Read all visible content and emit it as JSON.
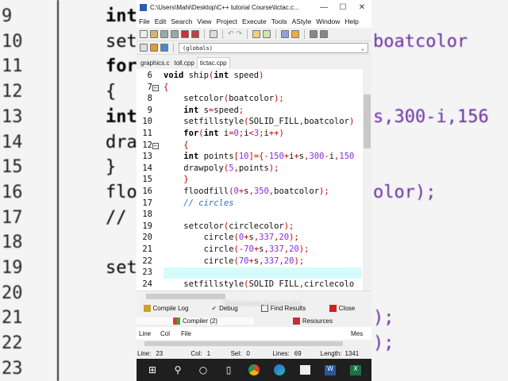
{
  "window": {
    "title": "C:\\Users\\Mahi\\Desktop\\C++ tutorial Course\\tictac.c...",
    "minimize": "—",
    "maximize": "☐",
    "close": "✕"
  },
  "menu": [
    "File",
    "Edit",
    "Search",
    "View",
    "Project",
    "Execute",
    "Tools",
    "AStyle",
    "Window",
    "Help"
  ],
  "scope_combo": {
    "value": "(globals)"
  },
  "file_tabs": [
    "graphics.c",
    "toll.cpp",
    "tictac.cpp"
  ],
  "active_tab": "tictac.cpp",
  "code_lines": [
    {
      "n": "6",
      "html": "<span class='kw'>void</span> ship<span class='p'>(</span><span class='kw'>int</span> speed<span class='p'>)</span>"
    },
    {
      "n": "7",
      "html": "<span class='p'>{</span>",
      "fold": true
    },
    {
      "n": "8",
      "html": "    setcolor<span class='p'>(</span>boatcolor<span class='p'>);</span>"
    },
    {
      "n": "9",
      "html": "    <span class='kw'>int</span> s<span class='p'>=</span>speed<span class='p'>;</span>"
    },
    {
      "n": "10",
      "html": "    setfillstyle<span class='p'>(</span>SOLID_FILL<span class='p'>,</span>boatcolor<span class='p'>)</span>"
    },
    {
      "n": "11",
      "html": "    <span class='kw'>for</span><span class='p'>(</span><span class='kw'>int</span> i<span class='p'>=</span><span class='n'>0</span><span class='p'>;</span>i<span class='p'>&lt;</span><span class='n'>3</span><span class='p'>;</span>i<span class='p'>++)</span>"
    },
    {
      "n": "12",
      "html": "    <span class='p'>{</span>",
      "fold": true
    },
    {
      "n": "13",
      "html": "    <span class='kw'>int</span> points<span class='p'>[</span><span class='n'>10</span><span class='p'>]={-</span><span class='n'>150</span><span class='p'>+</span>i<span class='p'>+</span>s<span class='p'>,</span><span class='n'>300</span><span class='p'>-</span>i<span class='p'>,</span><span class='n'>150</span>"
    },
    {
      "n": "14",
      "html": "    drawpoly<span class='p'>(</span><span class='n'>5</span><span class='p'>,</span>points<span class='p'>);</span>"
    },
    {
      "n": "15",
      "html": "    <span class='p'>}</span>"
    },
    {
      "n": "16",
      "html": "    floodfill<span class='p'>(</span><span class='n'>0</span><span class='p'>+</span>s<span class='p'>,</span><span class='n'>350</span><span class='p'>,</span>boatcolor<span class='p'>);</span>"
    },
    {
      "n": "17",
      "html": "    <span class='cm'>// circles</span>"
    },
    {
      "n": "18",
      "html": ""
    },
    {
      "n": "19",
      "html": "    setcolor<span class='p'>(</span>circlecolor<span class='p'>);</span>"
    },
    {
      "n": "20",
      "html": "        circle<span class='p'>(</span><span class='n'>0</span><span class='p'>+</span>s<span class='p'>,</span><span class='n'>337</span><span class='p'>,</span><span class='n'>20</span><span class='p'>);</span>"
    },
    {
      "n": "21",
      "html": "        circle<span class='p'>(-</span><span class='n'>70</span><span class='p'>+</span>s<span class='p'>,</span><span class='n'>337</span><span class='p'>,</span><span class='n'>20</span><span class='p'>);</span>"
    },
    {
      "n": "22",
      "html": "        circle<span class='p'>(</span><span class='n'>70</span><span class='p'>+</span>s<span class='p'>,</span><span class='n'>337</span><span class='p'>,</span><span class='n'>20</span><span class='p'>);</span>"
    },
    {
      "n": "23",
      "html": "",
      "current": true
    },
    {
      "n": "24",
      "html": "    setfillstyle<span class='p'>(</span>SOLID FILL<span class='p'>,</span>circlecolo"
    }
  ],
  "bottom_tabs": {
    "compile_log": "Compile Log",
    "debug": "Debug",
    "find_results": "Find Results",
    "close": "Close",
    "compiler": "Compiler (2)",
    "resources": "Resources"
  },
  "watermark": "Wondershare DemoCreator",
  "results_table": {
    "columns": [
      "Line",
      "Col",
      "File",
      "Mes"
    ]
  },
  "status": {
    "line_label": "Line:",
    "line": "23",
    "col_label": "Col:",
    "col": "1",
    "sel_label": "Sel:",
    "sel": "0",
    "lines_label": "Lines:",
    "lines": "69",
    "length_label": "Length:",
    "length": "1341"
  },
  "background_left": [
    [
      "9",
      "int"
    ],
    [
      "10",
      "setc"
    ],
    [
      "11",
      "for"
    ],
    [
      "12",
      "{"
    ],
    [
      "13",
      "int"
    ],
    [
      "14",
      "draw"
    ],
    [
      "15",
      "}"
    ],
    [
      "16",
      "floo"
    ],
    [
      "17",
      "//"
    ],
    [
      "18",
      ""
    ],
    [
      "19",
      "set"
    ],
    [
      "20",
      ""
    ],
    [
      "21",
      ""
    ],
    [
      "22",
      ""
    ],
    [
      "23",
      ""
    ]
  ],
  "background_right": [
    [
      "10",
      "boatcolor"
    ],
    [
      "13",
      "s,300-i,156"
    ],
    [
      "16",
      "olor);"
    ],
    [
      "21",
      ");"
    ],
    [
      "22",
      ");"
    ]
  ],
  "taskbar": [
    "windows-start",
    "search",
    "cortana",
    "task-view",
    "chrome",
    "edge",
    "store",
    "word",
    "excel"
  ]
}
